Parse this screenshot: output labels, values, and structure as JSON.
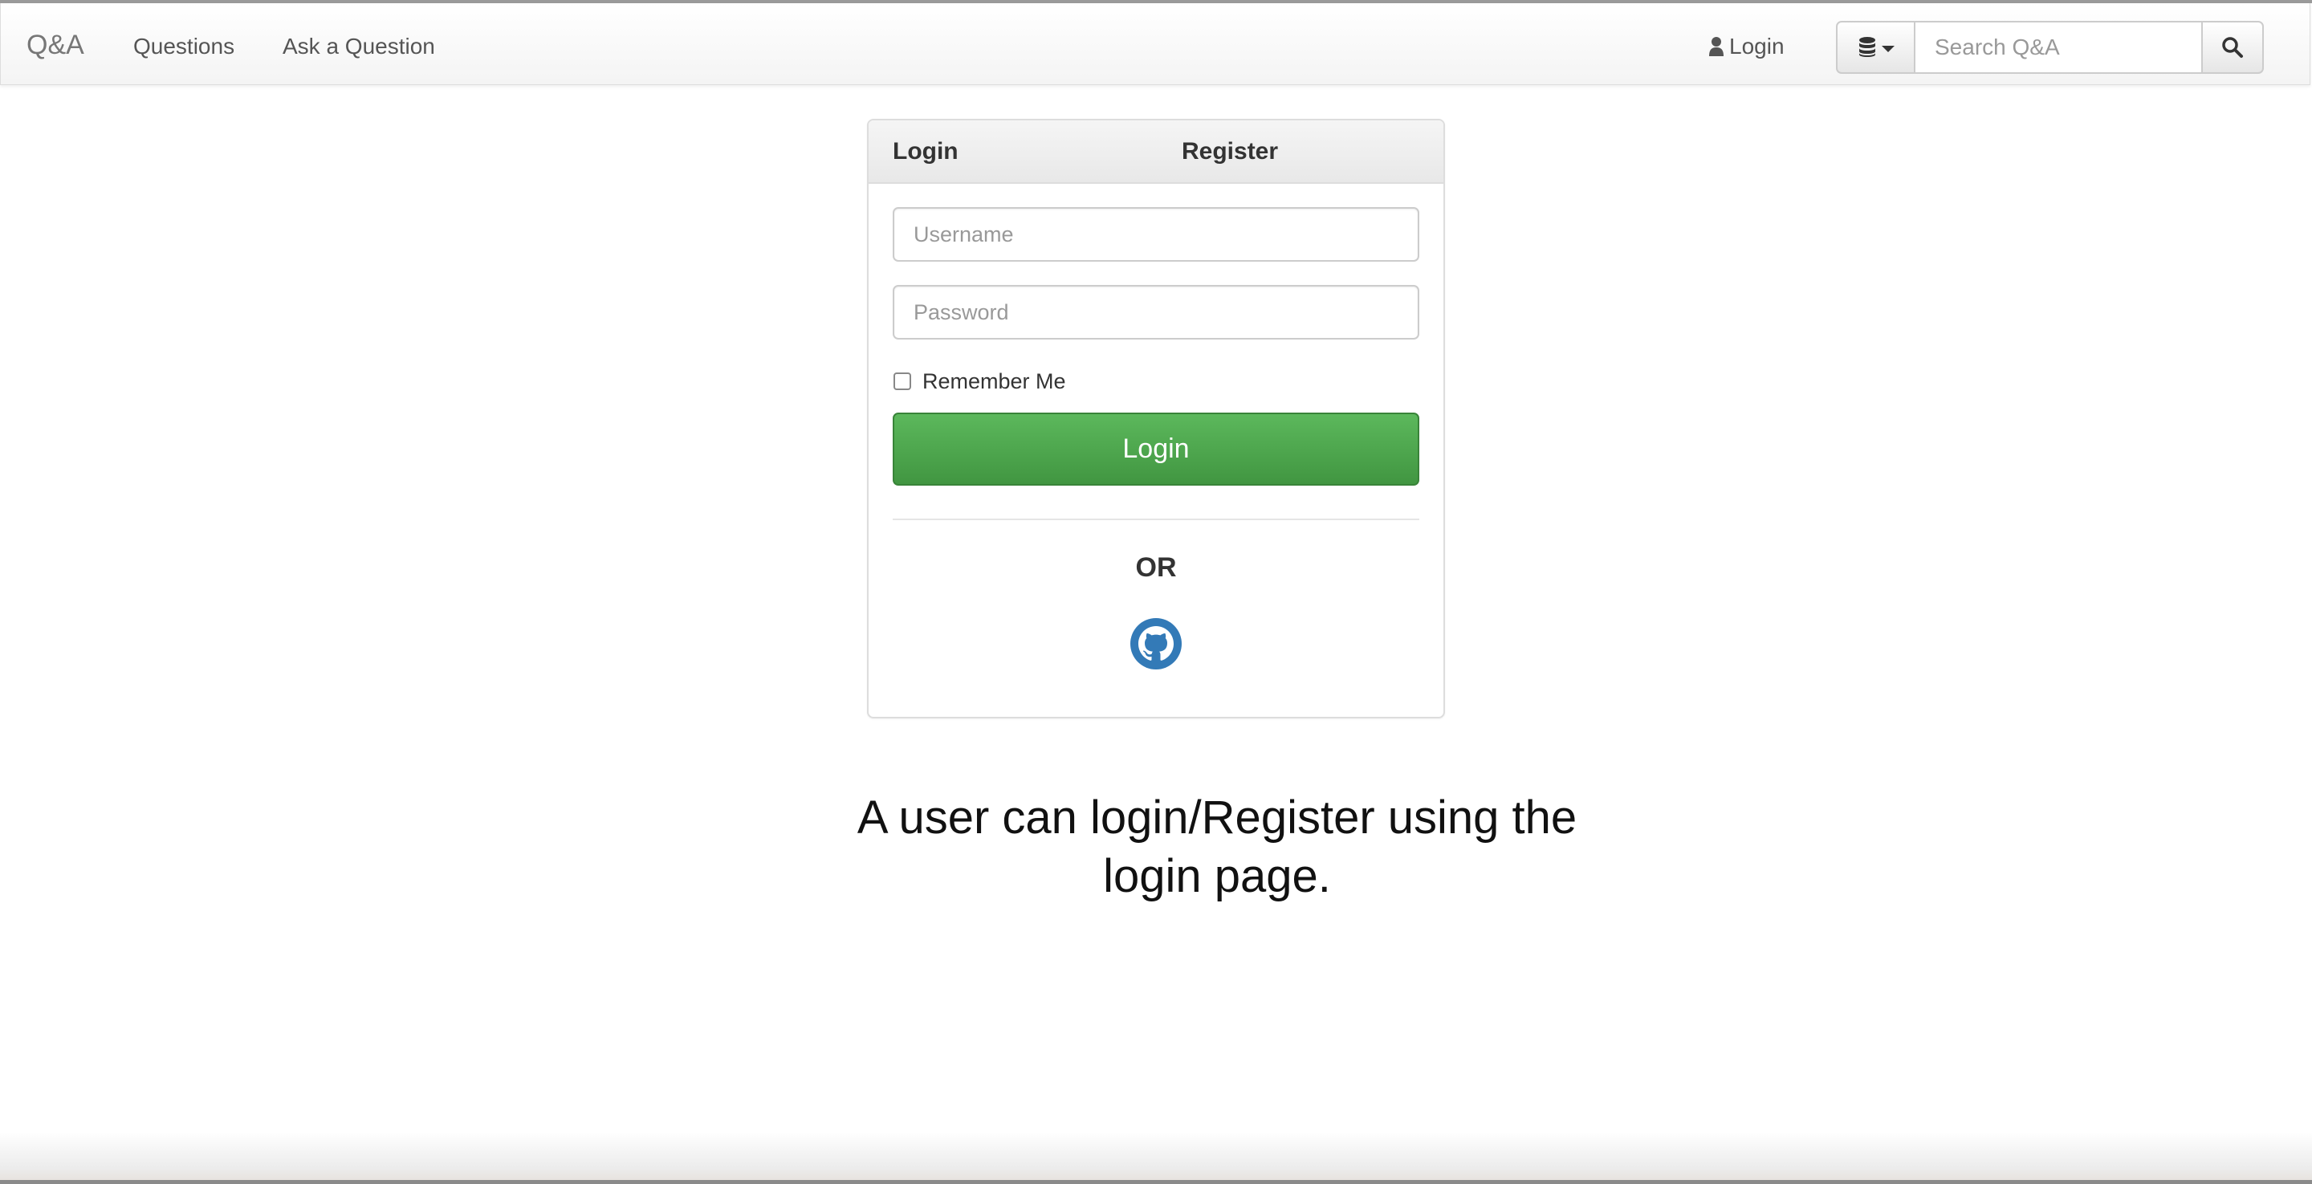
{
  "navbar": {
    "brand": "Q&A",
    "links": [
      {
        "label": "Questions"
      },
      {
        "label": "Ask a Question"
      }
    ],
    "login_label": "Login",
    "search": {
      "placeholder": "Search Q&A",
      "value": ""
    },
    "icons": {
      "user": "user-icon",
      "database": "database-icon",
      "caret": "caret-down-icon",
      "search": "search-icon"
    }
  },
  "login_panel": {
    "tabs": [
      {
        "label": "Login",
        "active": true
      },
      {
        "label": "Register",
        "active": false
      }
    ],
    "username": {
      "placeholder": "Username",
      "value": ""
    },
    "password": {
      "placeholder": "Password",
      "value": ""
    },
    "remember_me": {
      "label": "Remember Me",
      "checked": false
    },
    "submit_label": "Login",
    "or_label": "OR",
    "social_icon": "github-icon",
    "colors": {
      "login_button": "#4cae4c",
      "github": "#337ab7"
    }
  },
  "caption": {
    "line1": "A user can login/Register using the",
    "line2": "login page."
  }
}
